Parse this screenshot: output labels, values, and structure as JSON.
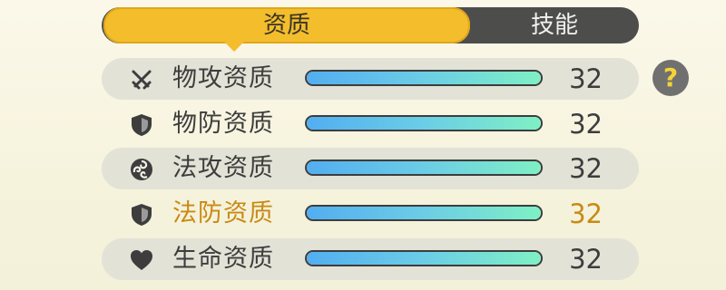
{
  "tabs": {
    "active_label": "资质",
    "inactive_label": "技能"
  },
  "help": {
    "glyph": "?"
  },
  "colors": {
    "accent": "#f3bd2c",
    "highlight_text": "#c98a14",
    "bar_start": "#52aef0",
    "bar_end": "#7ff0c4"
  },
  "stats": [
    {
      "icon": "crossed-swords-icon",
      "label": "物攻资质",
      "value": "32",
      "fill": 1.0
    },
    {
      "icon": "shield-icon",
      "label": "物防资质",
      "value": "32",
      "fill": 1.0
    },
    {
      "icon": "magic-swirl-icon",
      "label": "法攻资质",
      "value": "32",
      "fill": 1.0
    },
    {
      "icon": "magic-shield-icon",
      "label": "法防资质",
      "value": "32",
      "fill": 1.0,
      "highlight": true
    },
    {
      "icon": "heart-icon",
      "label": "生命资质",
      "value": "32",
      "fill": 1.0
    }
  ]
}
